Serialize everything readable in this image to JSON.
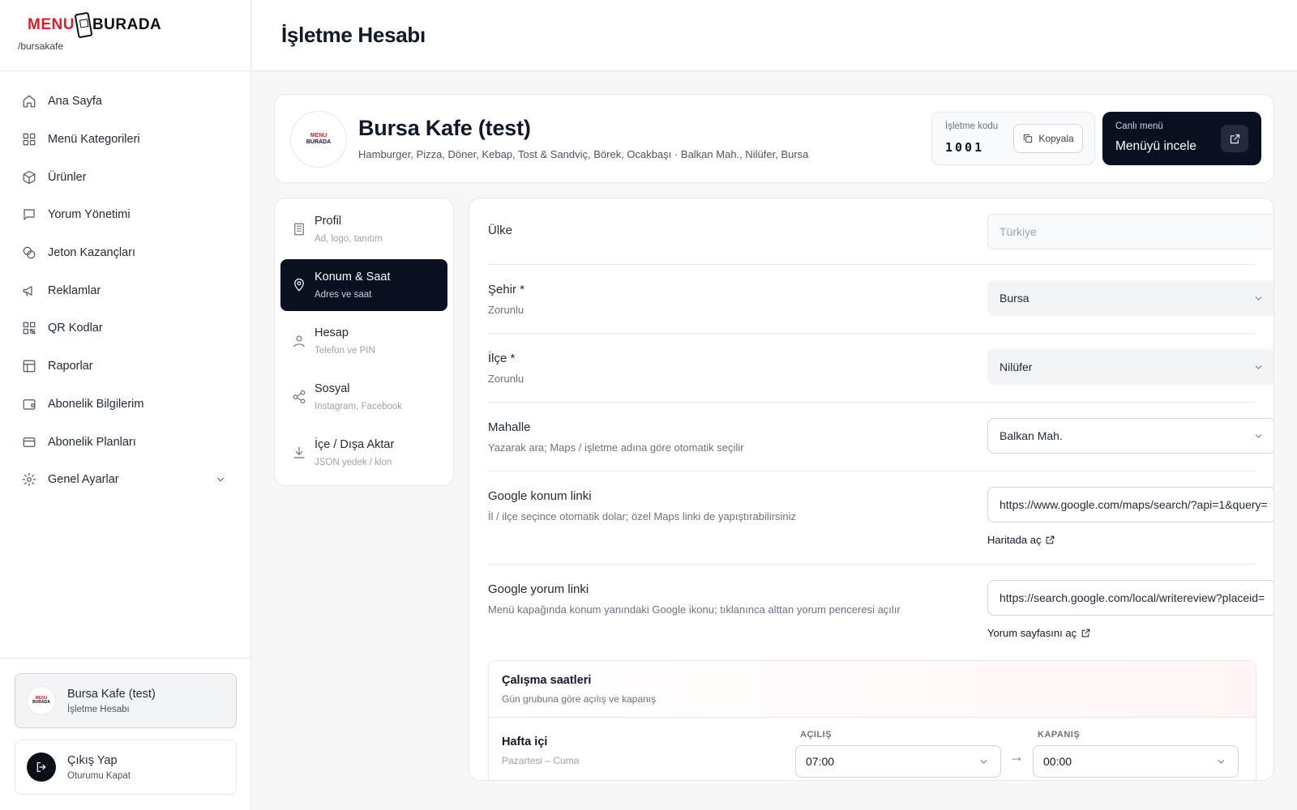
{
  "brand": {
    "logo_left": "MENU",
    "logo_right": "BURADA",
    "slug": "/bursakafe"
  },
  "page": {
    "title": "İşletme Hesabı"
  },
  "sidebar": {
    "items": [
      {
        "label": "Ana Sayfa",
        "icon": "home-icon"
      },
      {
        "label": "Menü Kategorileri",
        "icon": "grid-icon"
      },
      {
        "label": "Ürünler",
        "icon": "package-icon"
      },
      {
        "label": "Yorum Yönetimi",
        "icon": "message-icon"
      },
      {
        "label": "Jeton Kazançları",
        "icon": "coins-icon"
      },
      {
        "label": "Reklamlar",
        "icon": "megaphone-icon"
      },
      {
        "label": "QR Kodlar",
        "icon": "qr-icon"
      },
      {
        "label": "Raporlar",
        "icon": "report-icon"
      },
      {
        "label": "Abonelik Bilgilerim",
        "icon": "wallet-icon"
      },
      {
        "label": "Abonelik Planları",
        "icon": "card-icon"
      },
      {
        "label": "Genel Ayarlar",
        "icon": "gear-icon"
      }
    ],
    "account": {
      "name": "Bursa Kafe (test)",
      "role": "İşletme Hesabı"
    },
    "logout": {
      "title": "Çıkış Yap",
      "sub": "Oturumu Kapat"
    }
  },
  "business": {
    "name": "Bursa Kafe (test)",
    "meta": "Hamburger, Pizza, Döner, Kebap, Tost & Sandviç, Börek, Ocakbaşı · Balkan Mah., Nilüfer, Bursa",
    "code_label": "İşletme kodu",
    "code": "1001",
    "copy_label": "Kopyala",
    "live_label": "Canlı menü",
    "live_title": "Menüyü incele"
  },
  "tabs": [
    {
      "title": "Profil",
      "sub": "Ad, logo, tanıtım",
      "active": false
    },
    {
      "title": "Konum & Saat",
      "sub": "Adres ve saat",
      "active": true
    },
    {
      "title": "Hesap",
      "sub": "Telefon ve PIN",
      "active": false
    },
    {
      "title": "Sosyal",
      "sub": "Instagram, Facebook",
      "active": false
    },
    {
      "title": "İçe / Dışa Aktar",
      "sub": "JSON yedek / klon",
      "active": false
    }
  ],
  "form": {
    "country": {
      "label": "Ülke",
      "value": "Türkiye"
    },
    "city": {
      "label": "Şehir *",
      "help": "Zorunlu",
      "value": "Bursa"
    },
    "district": {
      "label": "İlçe *",
      "help": "Zorunlu",
      "value": "Nilüfer"
    },
    "neighborhood": {
      "label": "Mahalle",
      "help": "Yazarak ara; Maps / işletme adına göre otomatik seçilir",
      "value": "Balkan Mah."
    },
    "maps_link": {
      "label": "Google konum linki",
      "help": "İl / ilçe seçince otomatik dolar; özel Maps linki de yapıştırabilirsiniz",
      "value": "https://www.google.com/maps/search/?api=1&query=",
      "action": "Haritada aç"
    },
    "review_link": {
      "label": "Google yorum linki",
      "help": "Menü kapağında konum yanındaki Google ikonu; tıklanınca alttan yorum penceresi açılır",
      "value": "https://search.google.com/local/writereview?placeid=",
      "action": "Yorum sayfasını aç"
    }
  },
  "hours": {
    "title": "Çalışma saatleri",
    "sub": "Gün grubuna göre açılış ve kapanış",
    "open_label": "AÇILIŞ",
    "close_label": "KAPANIŞ",
    "arrow": "→",
    "rows": [
      {
        "title": "Hafta içi",
        "sub": "Pazartesi – Cuma",
        "open": "07:00",
        "close": "00:00"
      }
    ]
  },
  "colors": {
    "accent_dark": "#0b1020",
    "brand_red": "#e11d2a"
  }
}
